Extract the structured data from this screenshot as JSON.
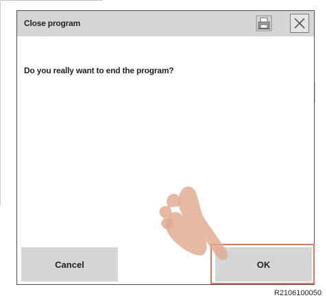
{
  "dialog": {
    "title": "Close program",
    "message": "Do you really want to end the program?",
    "cancel_label": "Cancel",
    "ok_label": "OK"
  },
  "caption": "R2106100050",
  "colors": {
    "titlebar_bg": "#d6d6d6",
    "button_bg": "#d6d6d6",
    "highlight_border": "#e2745c",
    "hand_fill": "#e0a98d"
  },
  "icons": {
    "print": "printer-icon",
    "close": "close-icon",
    "pointer": "hand-pointer"
  }
}
